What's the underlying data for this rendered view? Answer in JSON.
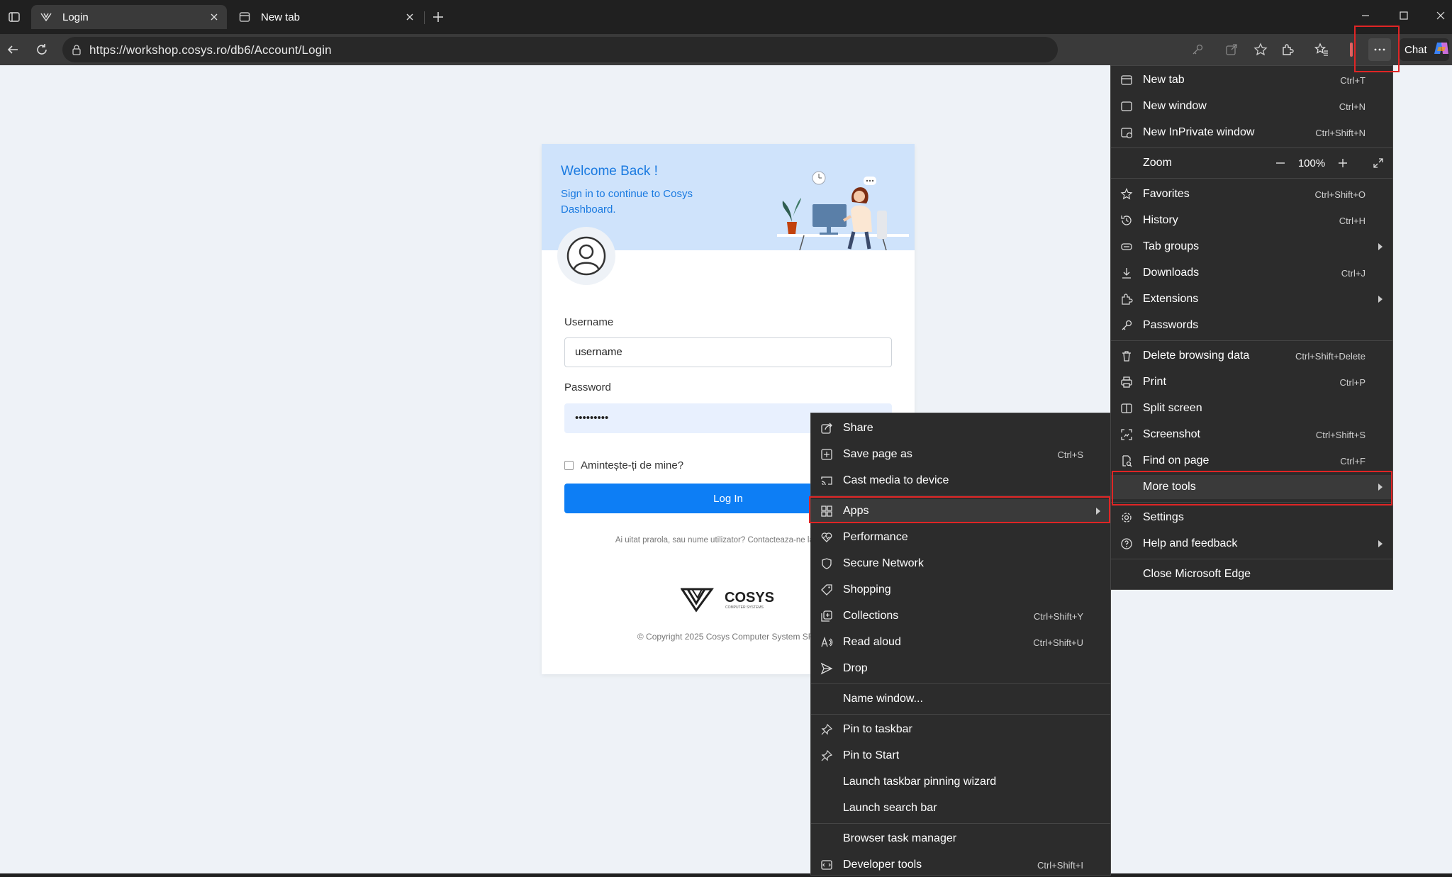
{
  "browser": {
    "tabs": [
      {
        "title": "Login",
        "active": true
      },
      {
        "title": "New tab",
        "active": false
      }
    ],
    "address_bar": {
      "url": "https://workshop.cosys.ro/db6/Account/Login"
    },
    "chat_label": "Chat"
  },
  "login": {
    "welcome": "Welcome Back !",
    "subtitle": "Sign in to continue to Cosys Dashboard.",
    "username_label": "Username",
    "username_value": "username",
    "password_label": "Password",
    "password_value": "•••••••••",
    "remember_label": "Amintește-ți de mine?",
    "login_button": "Log In",
    "forgot_text": "Ai uitat prarola, sau nume utilizator? Contacteaza-ne la adresa",
    "logo_text": "COSYS",
    "logo_subtext": "COMPUTER SYSTEMS",
    "copyright": "© Copyright 2025 Cosys Computer System SRL"
  },
  "main_menu": {
    "new_tab": {
      "label": "New tab",
      "shortcut": "Ctrl+T"
    },
    "new_window": {
      "label": "New window",
      "shortcut": "Ctrl+N"
    },
    "new_inprivate": {
      "label": "New InPrivate window",
      "shortcut": "Ctrl+Shift+N"
    },
    "zoom": {
      "label": "Zoom",
      "value": "100%"
    },
    "favorites": {
      "label": "Favorites",
      "shortcut": "Ctrl+Shift+O"
    },
    "history": {
      "label": "History",
      "shortcut": "Ctrl+H"
    },
    "tab_groups": {
      "label": "Tab groups"
    },
    "downloads": {
      "label": "Downloads",
      "shortcut": "Ctrl+J"
    },
    "extensions": {
      "label": "Extensions"
    },
    "passwords": {
      "label": "Passwords"
    },
    "delete_data": {
      "label": "Delete browsing data",
      "shortcut": "Ctrl+Shift+Delete"
    },
    "print": {
      "label": "Print",
      "shortcut": "Ctrl+P"
    },
    "split_screen": {
      "label": "Split screen"
    },
    "screenshot": {
      "label": "Screenshot",
      "shortcut": "Ctrl+Shift+S"
    },
    "find": {
      "label": "Find on page",
      "shortcut": "Ctrl+F"
    },
    "more_tools": {
      "label": "More tools"
    },
    "settings": {
      "label": "Settings"
    },
    "help": {
      "label": "Help and feedback"
    },
    "close": {
      "label": "Close Microsoft Edge"
    }
  },
  "more_tools_menu": {
    "share": {
      "label": "Share"
    },
    "save_page": {
      "label": "Save page as",
      "shortcut": "Ctrl+S"
    },
    "cast": {
      "label": "Cast media to device"
    },
    "apps": {
      "label": "Apps"
    },
    "performance": {
      "label": "Performance"
    },
    "secure_network": {
      "label": "Secure Network"
    },
    "shopping": {
      "label": "Shopping"
    },
    "collections": {
      "label": "Collections",
      "shortcut": "Ctrl+Shift+Y"
    },
    "read_aloud": {
      "label": "Read aloud",
      "shortcut": "Ctrl+Shift+U"
    },
    "drop": {
      "label": "Drop"
    },
    "name_window": {
      "label": "Name window..."
    },
    "pin_taskbar": {
      "label": "Pin to taskbar"
    },
    "pin_start": {
      "label": "Pin to Start"
    },
    "taskbar_wizard": {
      "label": "Launch taskbar pinning wizard"
    },
    "search_bar": {
      "label": "Launch search bar"
    },
    "task_manager": {
      "label": "Browser task manager"
    },
    "dev_tools": {
      "label": "Developer tools",
      "shortcut": "Ctrl+Shift+I"
    }
  },
  "colors": {
    "highlight": "#e02525",
    "primary": "#0d7ef5",
    "menu_bg": "#2c2c2c"
  }
}
